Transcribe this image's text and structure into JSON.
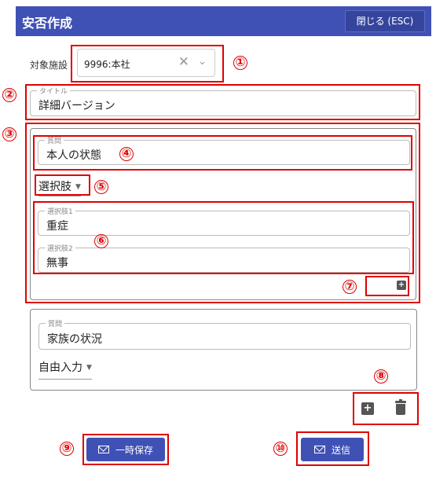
{
  "header": {
    "title": "安否作成",
    "close_label": "閉じる (ESC)"
  },
  "facility": {
    "label": "対象施設",
    "value": "9996:本社"
  },
  "title_field": {
    "label": "タイトル",
    "value": "詳細バージョン"
  },
  "questions": [
    {
      "question_label": "質問",
      "question_value": "本人の状態",
      "type": "選択肢",
      "choices": [
        {
          "label": "選択肢1",
          "value": "重症"
        },
        {
          "label": "選択肢2",
          "value": "無事"
        }
      ]
    },
    {
      "question_label": "質問",
      "question_value": "家族の状況",
      "type": "自由入力"
    }
  ],
  "buttons": {
    "save_label": "一時保存",
    "send_label": "送信"
  },
  "markers": [
    "①",
    "②",
    "③",
    "④",
    "⑤",
    "⑥",
    "⑦",
    "⑧",
    "⑨",
    "⑩"
  ],
  "colors": {
    "primary": "#3f51b5",
    "highlight": "#e00000"
  }
}
